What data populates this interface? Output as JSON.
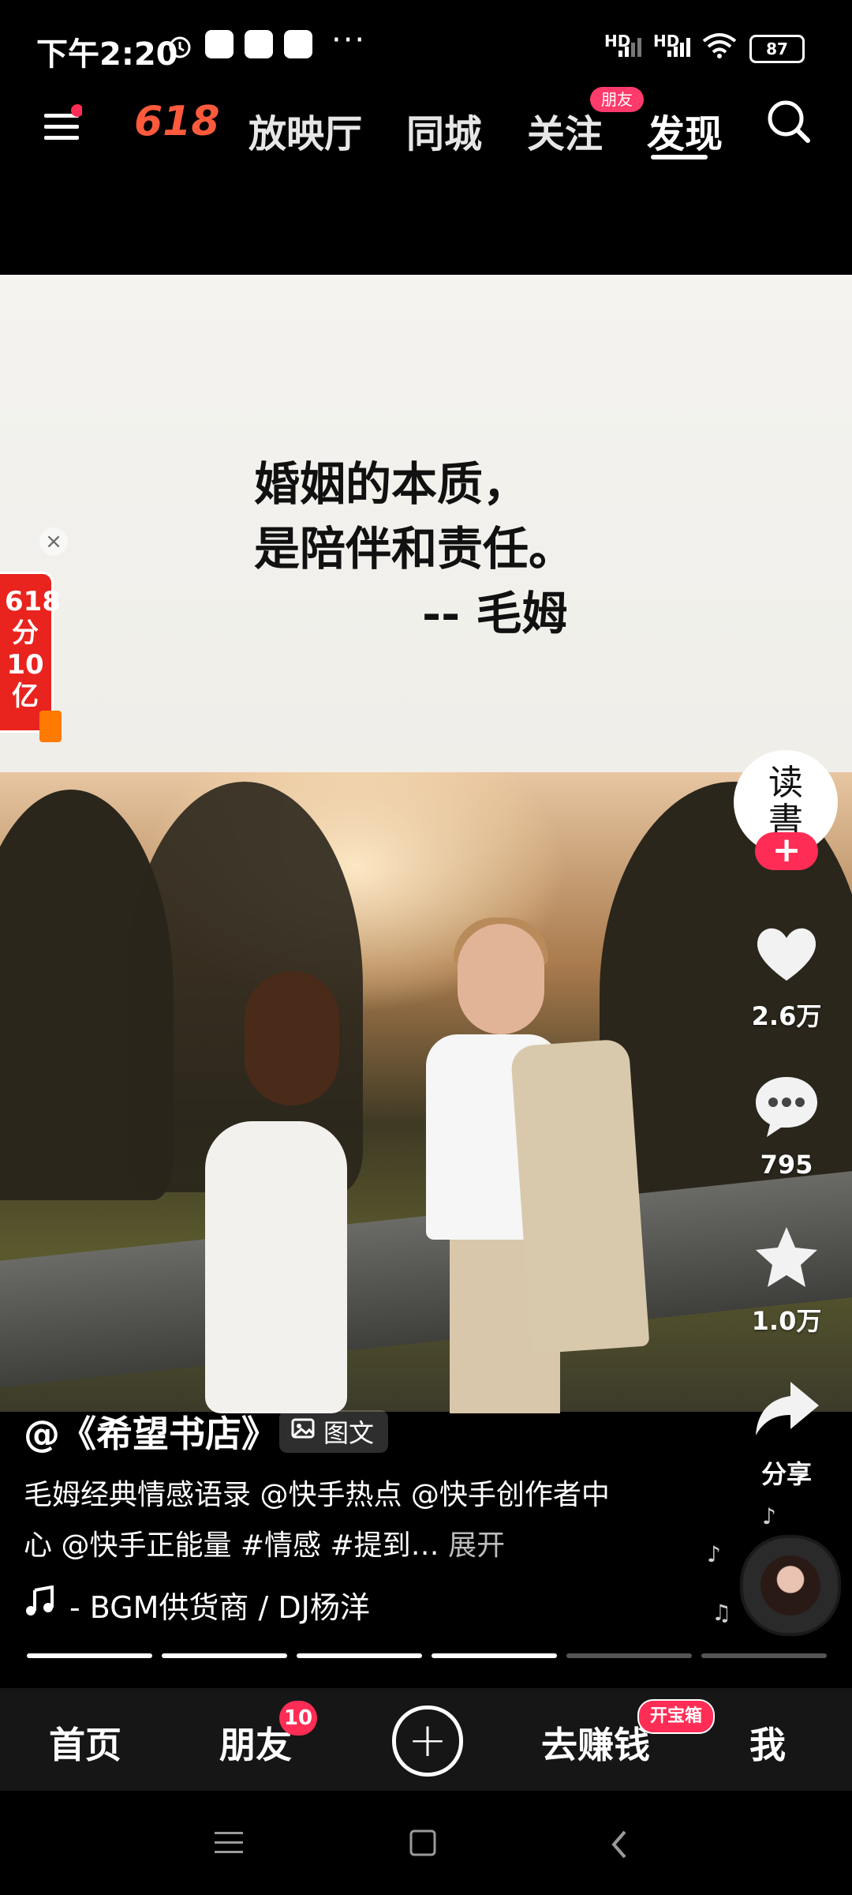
{
  "status_bar": {
    "time": "下午2:20",
    "more": "···",
    "network1": "HD",
    "network2": "HD",
    "battery": "87"
  },
  "top_nav": {
    "menu_icon": "hamburger-menu-icon",
    "logo": "618",
    "tabs": [
      "放映厅",
      "同城",
      "关注",
      "发现"
    ],
    "friend_badge": "朋友",
    "active_tab": "发现",
    "search_icon": "search-icon"
  },
  "content": {
    "quote_line1": "婚姻的本质，",
    "quote_line2": "是陪伴和责任。",
    "quote_author": "-- 毛姆"
  },
  "promo": {
    "text": "618分10亿",
    "close_icon": "close-icon"
  },
  "right_rail": {
    "avatar_text_top": "读",
    "avatar_text_bottom": "書",
    "follow_label": "+",
    "like_count": "2.6万",
    "comment_count": "795",
    "favorite_count": "1.0万",
    "share_label": "分享"
  },
  "caption": {
    "author": "@《希望书店》",
    "type_chip": "图文",
    "description": "毛姆经典情感语录 @快手热点 @快手创作者中心 @快手正能量 #情感 #提到…",
    "expand": "展开",
    "music": "- BGM供货商 / DJ杨洋"
  },
  "progress": {
    "total_segments": 6,
    "completed_segments": 4
  },
  "bottom_nav": {
    "home": "首页",
    "friends": "朋友",
    "friends_badge": "10",
    "earn": "去赚钱",
    "earn_badge": "开宝箱",
    "me": "我",
    "plus": "+"
  },
  "colors": {
    "accent": "#ff2d55",
    "background": "#000000"
  }
}
